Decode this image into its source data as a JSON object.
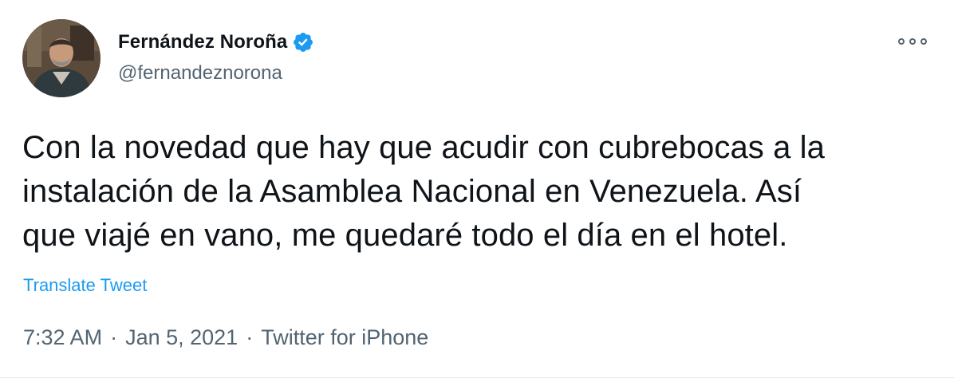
{
  "tweet": {
    "author": {
      "display_name": "Fernández Noroña",
      "handle": "@fernandeznorona",
      "verified": true
    },
    "text_lines": [
      "Con la novedad que hay que acudir con cubrebocas a la",
      "instalación de la Asamblea Nacional en Venezuela. Así",
      "que viajé en vano, me quedaré todo el día en el hotel."
    ],
    "translate_label": "Translate Tweet",
    "time": "7:32 AM",
    "date": "Jan 5, 2021",
    "separator": "·",
    "source": "Twitter for iPhone"
  },
  "icons": {
    "verified": "verified-badge-icon",
    "more": "more-options-icon"
  },
  "colors": {
    "accent": "#1d9bf0",
    "text_primary": "#0f1419",
    "text_secondary": "#536471"
  }
}
